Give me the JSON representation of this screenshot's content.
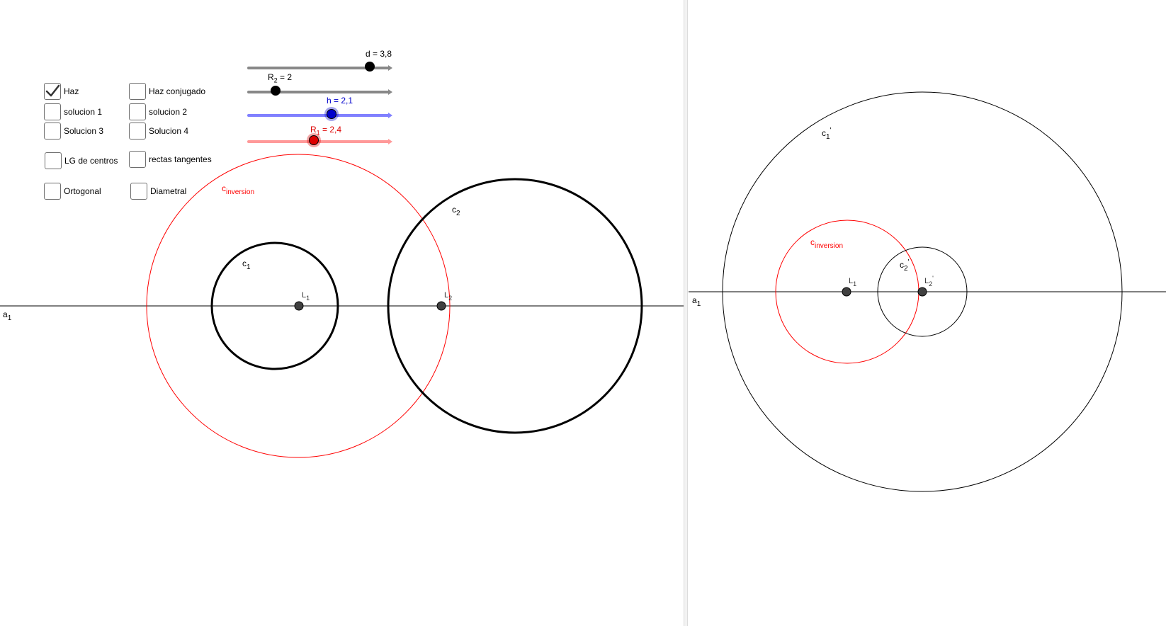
{
  "checkboxes": {
    "haz": {
      "label": "Haz",
      "checked": true
    },
    "haz_conjugado": {
      "label": "Haz conjugado",
      "checked": false
    },
    "solucion1": {
      "label": "solucion 1",
      "checked": false
    },
    "solucion2": {
      "label": "solucion 2",
      "checked": false
    },
    "solucion3": {
      "label": "Solucion 3",
      "checked": false
    },
    "solucion4": {
      "label": "Solucion 4",
      "checked": false
    },
    "lg_centros": {
      "label": "LG de centros",
      "checked": false
    },
    "rectas_tangentes": {
      "label": "rectas tangentes",
      "checked": false
    },
    "ortogonal": {
      "label": "Ortogonal",
      "checked": false
    },
    "diametral": {
      "label": "Diametral",
      "checked": false
    }
  },
  "sliders": {
    "d": {
      "name": "d",
      "value": "3,8",
      "level": 0.87,
      "color": "#888888",
      "knob": "#000000"
    },
    "r2": {
      "name": "R",
      "sub": "2",
      "value": "2",
      "level": 0.2,
      "color": "#888888",
      "knob": "#000000"
    },
    "h": {
      "name": "h",
      "value": "2,1",
      "level": 0.6,
      "color": "#8080ff",
      "knob": "#0000cc"
    },
    "r1": {
      "name": "R",
      "sub": "1",
      "value": "2,4",
      "level": 0.47,
      "color": "#ff9999",
      "knob": "#dd0000"
    }
  },
  "left_view": {
    "line_label": {
      "base": "a",
      "sub": "1"
    },
    "c_inversion": {
      "base": "c",
      "sub": "inversion",
      "color": "#ff0000"
    },
    "c1": {
      "base": "c",
      "sub": "1"
    },
    "c2": {
      "base": "c",
      "sub": "2"
    },
    "L1": {
      "base": "L",
      "sub": "1"
    },
    "L2": {
      "base": "L",
      "sub": "2"
    }
  },
  "right_view": {
    "line_label": {
      "base": "a",
      "sub": "1"
    },
    "c1p": {
      "base": "c",
      "sub": "1",
      "prime": "'"
    },
    "c_inversion": {
      "base": "c",
      "sub": "inversion",
      "color": "#ff0000"
    },
    "c2p": {
      "base": "c",
      "sub": "2",
      "prime": "'"
    },
    "L1": {
      "base": "L",
      "sub": "1"
    },
    "L2p": {
      "base": "L",
      "sub": "2",
      "prime": "'"
    }
  },
  "colors": {
    "inversion": "#ff0000",
    "curve": "#000000",
    "point": "#404040",
    "axis": "#000000"
  }
}
